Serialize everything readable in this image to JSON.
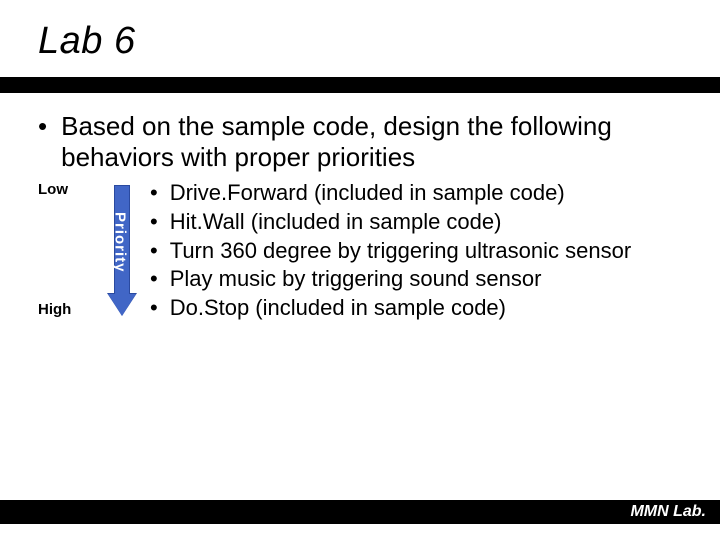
{
  "title": "Lab 6",
  "main_bullet": "Based on the sample code, design the following behaviors with proper priorities",
  "priority": {
    "low_label": "Low",
    "high_label": "High",
    "arrow_label": "Priority"
  },
  "behaviors": [
    "Drive.Forward (included in sample code)",
    "Hit.Wall (included in sample code)",
    "Turn 360 degree by triggering ultrasonic sensor",
    "Play music by triggering sound sensor",
    "Do.Stop (included in sample code)"
  ],
  "footer": "MMN Lab."
}
